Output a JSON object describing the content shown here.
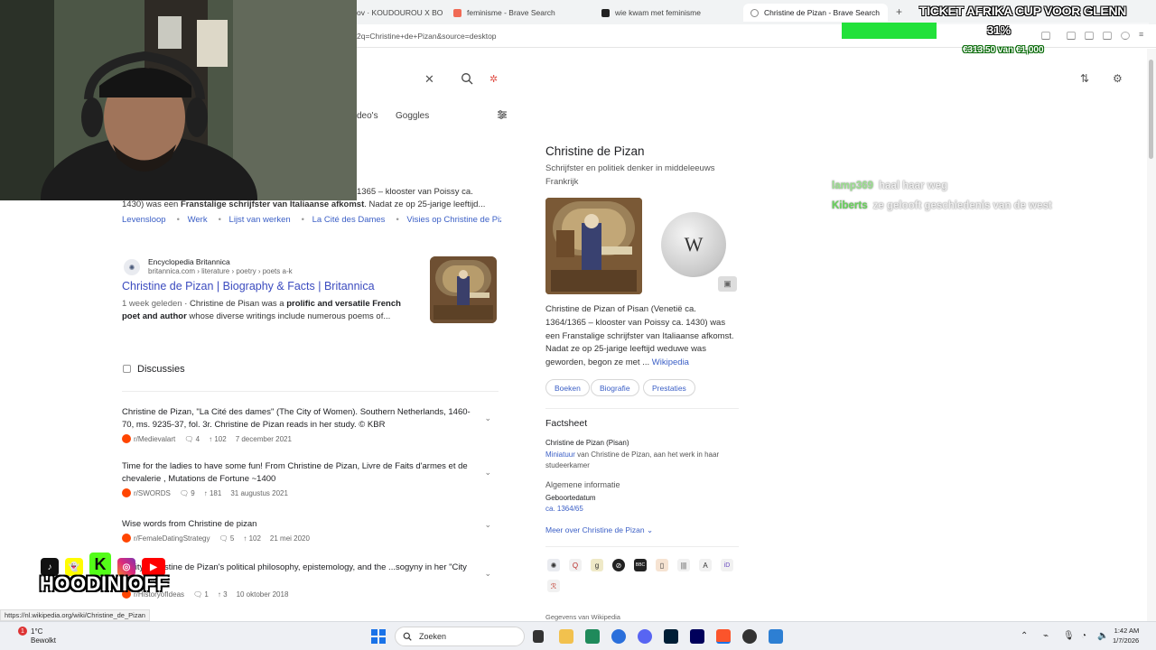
{
  "browser": {
    "tabs": [
      {
        "label": "ov · KOUDOUROU X BO!",
        "favicon_color": "#ffffff"
      },
      {
        "label": "feminisme - Brave Search",
        "favicon_color": "#f06a55"
      },
      {
        "label": "wie kwam met feminisme",
        "favicon_color": "#222222"
      },
      {
        "label": "Christine de Pizan - Brave Search",
        "favicon_color": "#888888"
      }
    ],
    "url": "2q=Christine+de+Pizan&source=desktop"
  },
  "search_header": {
    "tabs": [
      "deo's",
      "Goggles"
    ]
  },
  "results": {
    "partial_snippet_line1": "1365 – klooster van Poissy ca.",
    "partial_snippet_line2_pre": "1430) was een ",
    "partial_snippet_line2_bold": "Franstalige schrijfster van Italiaanse afkomst",
    "partial_snippet_line2_post": ". Nadat ze op 25-jarige leeftijd...",
    "deeplinks": [
      "Levensloop",
      "Werk",
      "Lijst van werken",
      "La Cité des Dames",
      "Visies op Christine de Pizan"
    ],
    "britannica": {
      "site_name": "Encyclopedia Britannica",
      "site_path": "britannica.com › literature › poetry › poets a-k",
      "title": "Christine de Pizan | Biography & Facts | Britannica",
      "age": "1 week geleden",
      "desc_pre": " · Christine de Pisan was a ",
      "desc_bold": "prolific and versatile French poet and author",
      "desc_post": " whose diverse writings include numerous poems of..."
    },
    "discussions": {
      "heading": "Discussies",
      "items": [
        {
          "title": "Christine de Pizan, \"La Cité des dames\" (The City of Women). Southern Netherlands, 1460-70, ms. 9235-37, fol. 3r. Christine de Pizan reads in her study. © KBR",
          "sub": "r/Medievalart",
          "comments": "4",
          "votes": "102",
          "date": "7 december 2021"
        },
        {
          "title": "Time for the ladies to have some fun! From Christine de Pizan, Livre de Faits d'armes et de chevalerie , Mutations de Fortune ~1400",
          "sub": "r/SWORDS",
          "comments": "9",
          "votes": "181",
          "date": "31 augustus 2021"
        },
        {
          "title": "Wise words from Christine de pizan",
          "sub": "r/FemaleDatingStrategy",
          "comments": "5",
          "votes": "102",
          "date": "21 mei 2020"
        },
        {
          "title": "...City: Christine de Pizan's political philosophy, epistemology, and the ...sogyny in her \"City of Ladies\"",
          "sub": "r/HistoryofIdeas",
          "comments": "1",
          "votes": "3",
          "date": "10 oktober 2018"
        }
      ]
    }
  },
  "knowledge_panel": {
    "title": "Christine de Pizan",
    "subtitle": "Schrijfster en politiek denker in middeleeuws Frankrijk",
    "desc": "Christine de Pizan of Pisan (Venetië ca. 1364/1365 – klooster van Poissy ca. 1430) was een Franstalige schrijfster van Italiaanse afkomst. Nadat ze op 25-jarige leeftijd weduwe was geworden, begon ze met ...",
    "desc_link": "Wikipedia",
    "chips": [
      "Boeken",
      "Biografie",
      "Prestaties"
    ],
    "factsheet_heading": "Factsheet",
    "fact_name": "Christine de Pizan (Pisan)",
    "miniature_link": "Miniatuur",
    "miniature_text": " van Christine de Pizan, aan het werk in haar studeerkamer",
    "general_heading": "Algemene informatie",
    "birth_label": "Geboortedatum",
    "birth_value": "ca. 1364/65",
    "more_link": "Meer over Christine de Pizan",
    "source_footer": "Gegevens van Wikipedia"
  },
  "chat": [
    {
      "user": "lamp369",
      "text": "haal haar weg"
    },
    {
      "user": "Kiberts",
      "text": "ze gelooft geschiedenis van de west"
    }
  ],
  "goal": {
    "title": "TICKET AFRIKA CUP VOOR GLENN",
    "percent_label": "31%",
    "amount": "€313.50 van €1,000",
    "fraction": 0.31,
    "fill_color": "#22e13a"
  },
  "stream_overlay": {
    "handle": "HOODINIOFF"
  },
  "status_url": "https://nl.wikipedia.org/wiki/Christine_de_Pizan",
  "taskbar": {
    "weather_temp": "1°C",
    "weather_text": "Bewolkt",
    "search_placeholder": "Zoeken",
    "time": "1:42 AM",
    "date": "1/7/2026"
  },
  "colors": {
    "link": "#3b5fc6",
    "title_link": "#3b4bbf",
    "reddit": "#ff4500"
  }
}
